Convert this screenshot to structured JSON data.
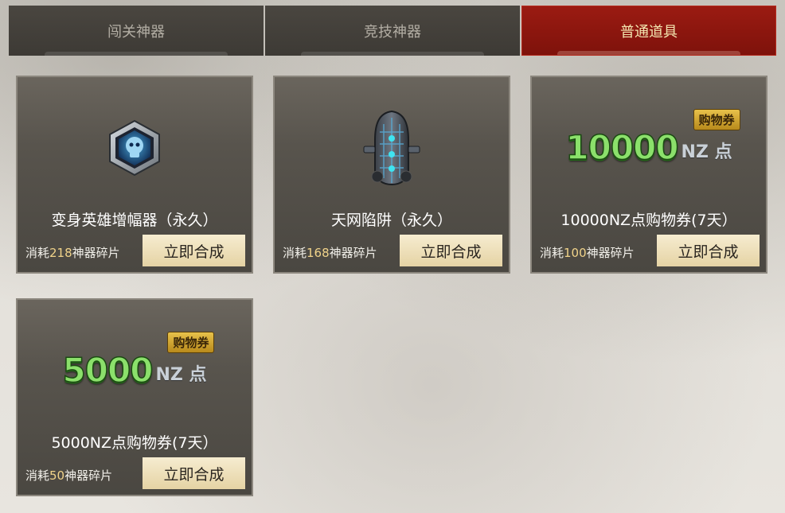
{
  "tabs": [
    {
      "label": "闯关神器",
      "active": false
    },
    {
      "label": "竞技神器",
      "active": false
    },
    {
      "label": "普通道具",
      "active": true
    }
  ],
  "cost_prefix": "消耗",
  "cost_suffix": "神器碎片",
  "button_label": "立即合成",
  "coupon_tag": "购物券",
  "coupon_unit": "NZ 点",
  "items": [
    {
      "name": "变身英雄增幅器（永久）",
      "cost": "218",
      "icon": "hero-amplifier-icon"
    },
    {
      "name": "天网陷阱（永久）",
      "cost": "168",
      "icon": "skynet-trap-icon"
    },
    {
      "name": "10000NZ点购物券(7天）",
      "cost": "100",
      "icon": "coupon-icon",
      "coupon_amount": "10000"
    },
    {
      "name": "5000NZ点购物券(7天）",
      "cost": "50",
      "icon": "coupon-icon",
      "coupon_amount": "5000"
    }
  ]
}
